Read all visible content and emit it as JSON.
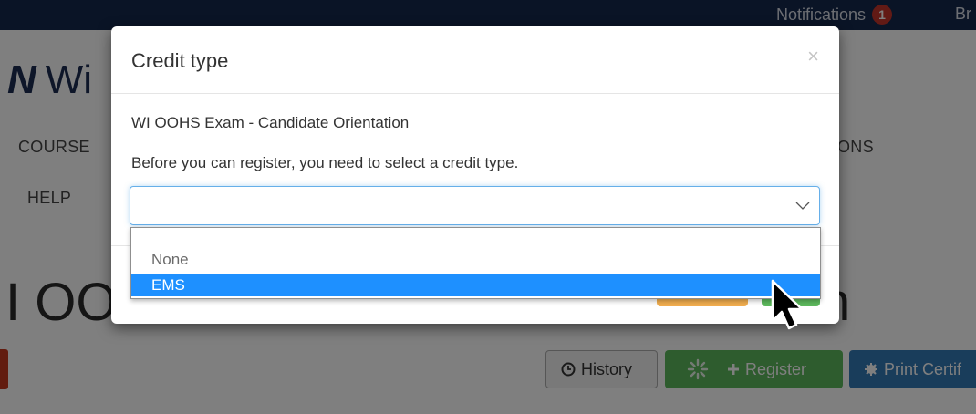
{
  "topbar": {
    "notifications_label": "Notifications",
    "notifications_count": "1",
    "user_abbr": "Br"
  },
  "brand": {
    "logo_text": "N",
    "name_fragment": "Wi"
  },
  "nav": {
    "courses_fragment": "COURSE",
    "help": "HELP",
    "right_fragment": "ONS"
  },
  "page": {
    "title_fragment": "I OO",
    "title_tail": "n"
  },
  "actions": {
    "history": "History",
    "register": "Register",
    "print": "Print Certif"
  },
  "modal": {
    "title": "Credit type",
    "close_symbol": "×",
    "course_name": "WI OOHS Exam - Candidate Orientation",
    "instruction": "Before you can register, you need to select a credit type.",
    "select_value": "",
    "options": [
      "None",
      "EMS"
    ],
    "highlighted_option": "EMS"
  },
  "colors": {
    "topbar": "#14284d",
    "highlight": "#1e90ff",
    "register_green": "#5cb85c",
    "print_blue": "#337ab7",
    "badge_red": "#c4342a"
  },
  "icons": {
    "close": "close-icon",
    "select_arrow": "chevron-down-icon",
    "history": "clock-icon",
    "register_loading": "spinner-icon",
    "register_plus": "plus-icon",
    "print": "certificate-icon",
    "pointer": "mouse-cursor-icon"
  }
}
